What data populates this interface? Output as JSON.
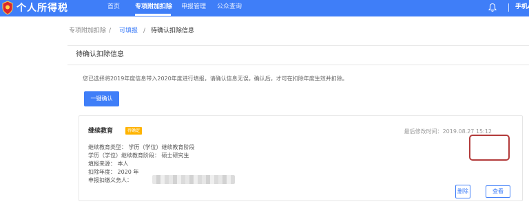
{
  "header": {
    "brand": "个人所得税",
    "brand_sub": "",
    "nav": [
      "首页",
      "专项附加扣除",
      "申报管理",
      "公众查询"
    ],
    "active_nav": "专项附加扣除",
    "phone_link": "手机AI"
  },
  "breadcrumb": {
    "items": [
      "专项附加扣除",
      "可填报",
      "待确认扣除信息"
    ],
    "separator": "/"
  },
  "panel": {
    "title": "待确认扣除信息",
    "notice": "您已选择将2019年度信息带入2020年度进行填报，请确认信息无误，确认后，才可在扣除年度生效并扣除。",
    "confirm_button": "一键确认"
  },
  "card": {
    "title": "继续教育",
    "badge": "待确定",
    "modified_label": "最后修改时间：",
    "modified_time": "2019.08.27 15:12",
    "fields": [
      "继续教育类型：  学历（学位）继续教育阶段",
      "学历（学位）继续教育阶段：  硕士研究生",
      "填报来源：  本人",
      "扣除年度：  2020 年",
      "申报扣缴义务人："
    ],
    "delete_button": "删除",
    "view_button": "查看"
  },
  "colors": {
    "primary": "#3f7ef8",
    "badge": "#ffb400",
    "highlight": "#b23a3a"
  }
}
